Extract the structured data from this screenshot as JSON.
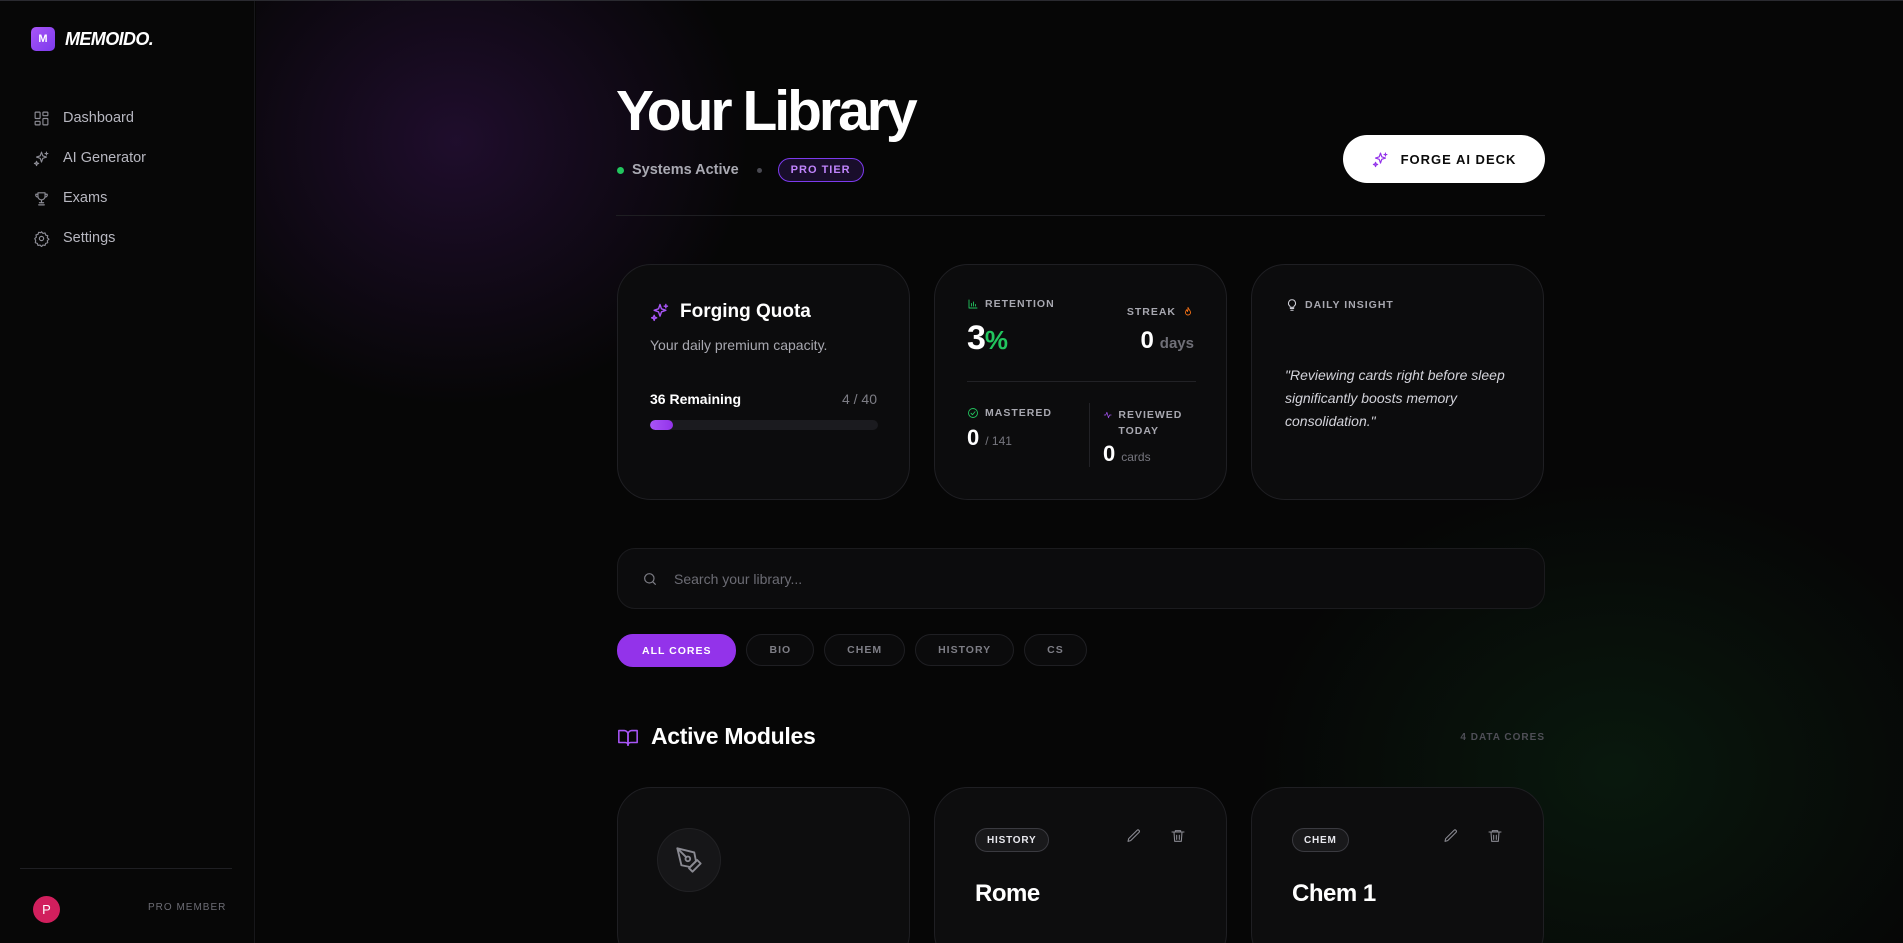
{
  "brand": {
    "mark": "M",
    "name": "MEMOIDO."
  },
  "sidebar": {
    "items": [
      {
        "label": "Dashboard",
        "icon": "grid-icon"
      },
      {
        "label": "AI Generator",
        "icon": "sparkles-icon"
      },
      {
        "label": "Exams",
        "icon": "trophy-icon"
      },
      {
        "label": "Settings",
        "icon": "gear-icon"
      }
    ],
    "user": {
      "initial": "P",
      "role": "PRO MEMBER"
    }
  },
  "header": {
    "title": "Your Library",
    "status": "Systems Active",
    "tier": "PRO TIER",
    "forge_button": "FORGE AI DECK"
  },
  "quota": {
    "title": "Forging Quota",
    "subtitle": "Your daily premium capacity.",
    "remaining": "36 Remaining",
    "count": "4 / 40",
    "progress_fraction": 0.1
  },
  "stats": {
    "retention_label": "RETENTION",
    "retention_value": "3",
    "retention_unit": "%",
    "streak_label": "STREAK",
    "streak_value": "0",
    "streak_unit": "days",
    "mastered_label": "MASTERED",
    "mastered_value": "0",
    "mastered_total": "/ 141",
    "reviewed_label": "REVIEWED TODAY",
    "reviewed_value": "0",
    "reviewed_unit": "cards"
  },
  "insight": {
    "label": "DAILY INSIGHT",
    "quote": "\"Reviewing cards right before sleep significantly boosts memory consolidation.\""
  },
  "search": {
    "placeholder": "Search your library..."
  },
  "filters": [
    "ALL CORES",
    "BIO",
    "CHEM",
    "HISTORY",
    "CS"
  ],
  "modules": {
    "title": "Active Modules",
    "count": "4 DATA CORES",
    "decks": [
      {
        "tag": "HISTORY",
        "name": "Rome"
      },
      {
        "tag": "CHEM",
        "name": "Chem 1"
      }
    ]
  },
  "colors": {
    "accent": "#9333ea",
    "success": "#22c55e",
    "streak": "#f97316",
    "background": "#050505"
  }
}
